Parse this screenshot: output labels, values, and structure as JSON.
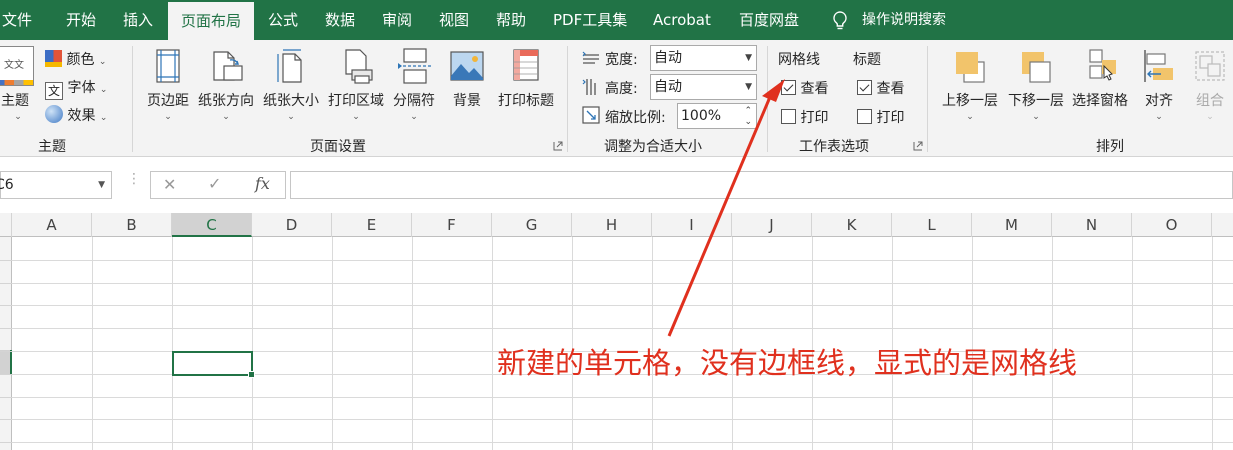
{
  "tabs": [
    {
      "label": "文件"
    },
    {
      "label": "开始"
    },
    {
      "label": "插入"
    },
    {
      "label": "页面布局",
      "active": true
    },
    {
      "label": "公式"
    },
    {
      "label": "数据"
    },
    {
      "label": "审阅"
    },
    {
      "label": "视图"
    },
    {
      "label": "帮助"
    },
    {
      "label": "PDF工具集"
    },
    {
      "label": "Acrobat"
    },
    {
      "label": "百度网盘"
    }
  ],
  "search_label": "操作说明搜索",
  "theme_group": {
    "theme_label": "主题",
    "colors_label": "颜色",
    "fonts_label": "字体",
    "effects_label": "效果",
    "group_label": "主题",
    "theme_icon_text": "文文"
  },
  "page_setup": {
    "buttons": [
      {
        "label": "页边距"
      },
      {
        "label": "纸张方向"
      },
      {
        "label": "纸张大小"
      },
      {
        "label": "打印区域"
      },
      {
        "label": "分隔符"
      },
      {
        "label": "背景"
      },
      {
        "label": "打印标题"
      }
    ],
    "group_label": "页面设置"
  },
  "scale_fit": {
    "width_label": "宽度:",
    "width_value": "自动",
    "height_label": "高度:",
    "height_value": "自动",
    "scale_label": "缩放比例:",
    "scale_value": "100%",
    "group_label": "调整为合适大小"
  },
  "sheet_options": {
    "gridlines_title": "网格线",
    "headings_title": "标题",
    "view_label": "查看",
    "print_label": "打印",
    "gridlines_view": true,
    "gridlines_print": false,
    "headings_view": true,
    "headings_print": false,
    "group_label": "工作表选项"
  },
  "arrange": {
    "buttons": [
      {
        "label": "上移一层"
      },
      {
        "label": "下移一层"
      },
      {
        "label": "选择窗格"
      },
      {
        "label": "对齐"
      },
      {
        "label": "组合"
      }
    ],
    "group_label": "排列"
  },
  "formula_bar": {
    "name_box": "C6",
    "fx": "fx",
    "cancel": "✕",
    "enter": "✓",
    "value": ""
  },
  "columns": [
    "A",
    "B",
    "C",
    "D",
    "E",
    "F",
    "G",
    "H",
    "I",
    "J",
    "K",
    "L",
    "M",
    "N",
    "O"
  ],
  "selected_column": "C",
  "annotation": "新建的单元格，没有边框线，显式的是网格线",
  "colors": {
    "ribbon_green": "#217346",
    "annotation_red": "#e0301e"
  }
}
